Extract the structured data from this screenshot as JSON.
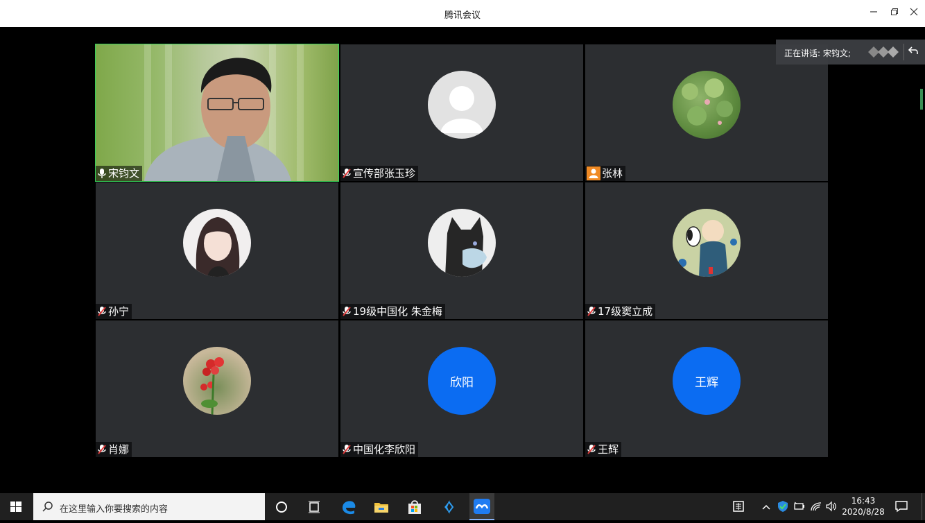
{
  "app": {
    "title": "腾讯会议"
  },
  "speaking": {
    "text": "正在讲话: 宋钧文;"
  },
  "participants": [
    {
      "name": "宋钧文",
      "mic": "on",
      "video": true
    },
    {
      "name": "宣传部张玉珍",
      "mic": "muted",
      "avatar": "default-person"
    },
    {
      "name": "张林",
      "mic": "none",
      "avatar": "lotus-photo"
    },
    {
      "name": "孙宁",
      "mic": "muted",
      "avatar": "girl-illustration"
    },
    {
      "name": "19级中国化 朱金梅",
      "mic": "muted",
      "avatar": "cat-illustration"
    },
    {
      "name": "17级窦立成",
      "mic": "muted",
      "avatar": "cartoon-boy-dog"
    },
    {
      "name": "肖娜",
      "mic": "muted",
      "avatar": "red-flower-photo"
    },
    {
      "name": "中国化李欣阳",
      "mic": "muted",
      "avatar_text": "欣阳"
    },
    {
      "name": "王辉",
      "mic": "muted",
      "avatar_text": "王辉"
    }
  ],
  "taskbar": {
    "search_placeholder": "在这里输入你要搜索的内容",
    "time": "16:43",
    "date": "2020/8/28",
    "apps": [
      "cortana-icon",
      "task-view-icon",
      "edge-icon",
      "file-explorer-icon",
      "store-icon",
      "vscode-icon",
      "tencent-meeting-icon"
    ]
  },
  "colors": {
    "tile_bg": "#2c2e31",
    "active_border": "#36d35a",
    "avatar_blue": "#0b6cf2",
    "taskbar": "#202020"
  }
}
